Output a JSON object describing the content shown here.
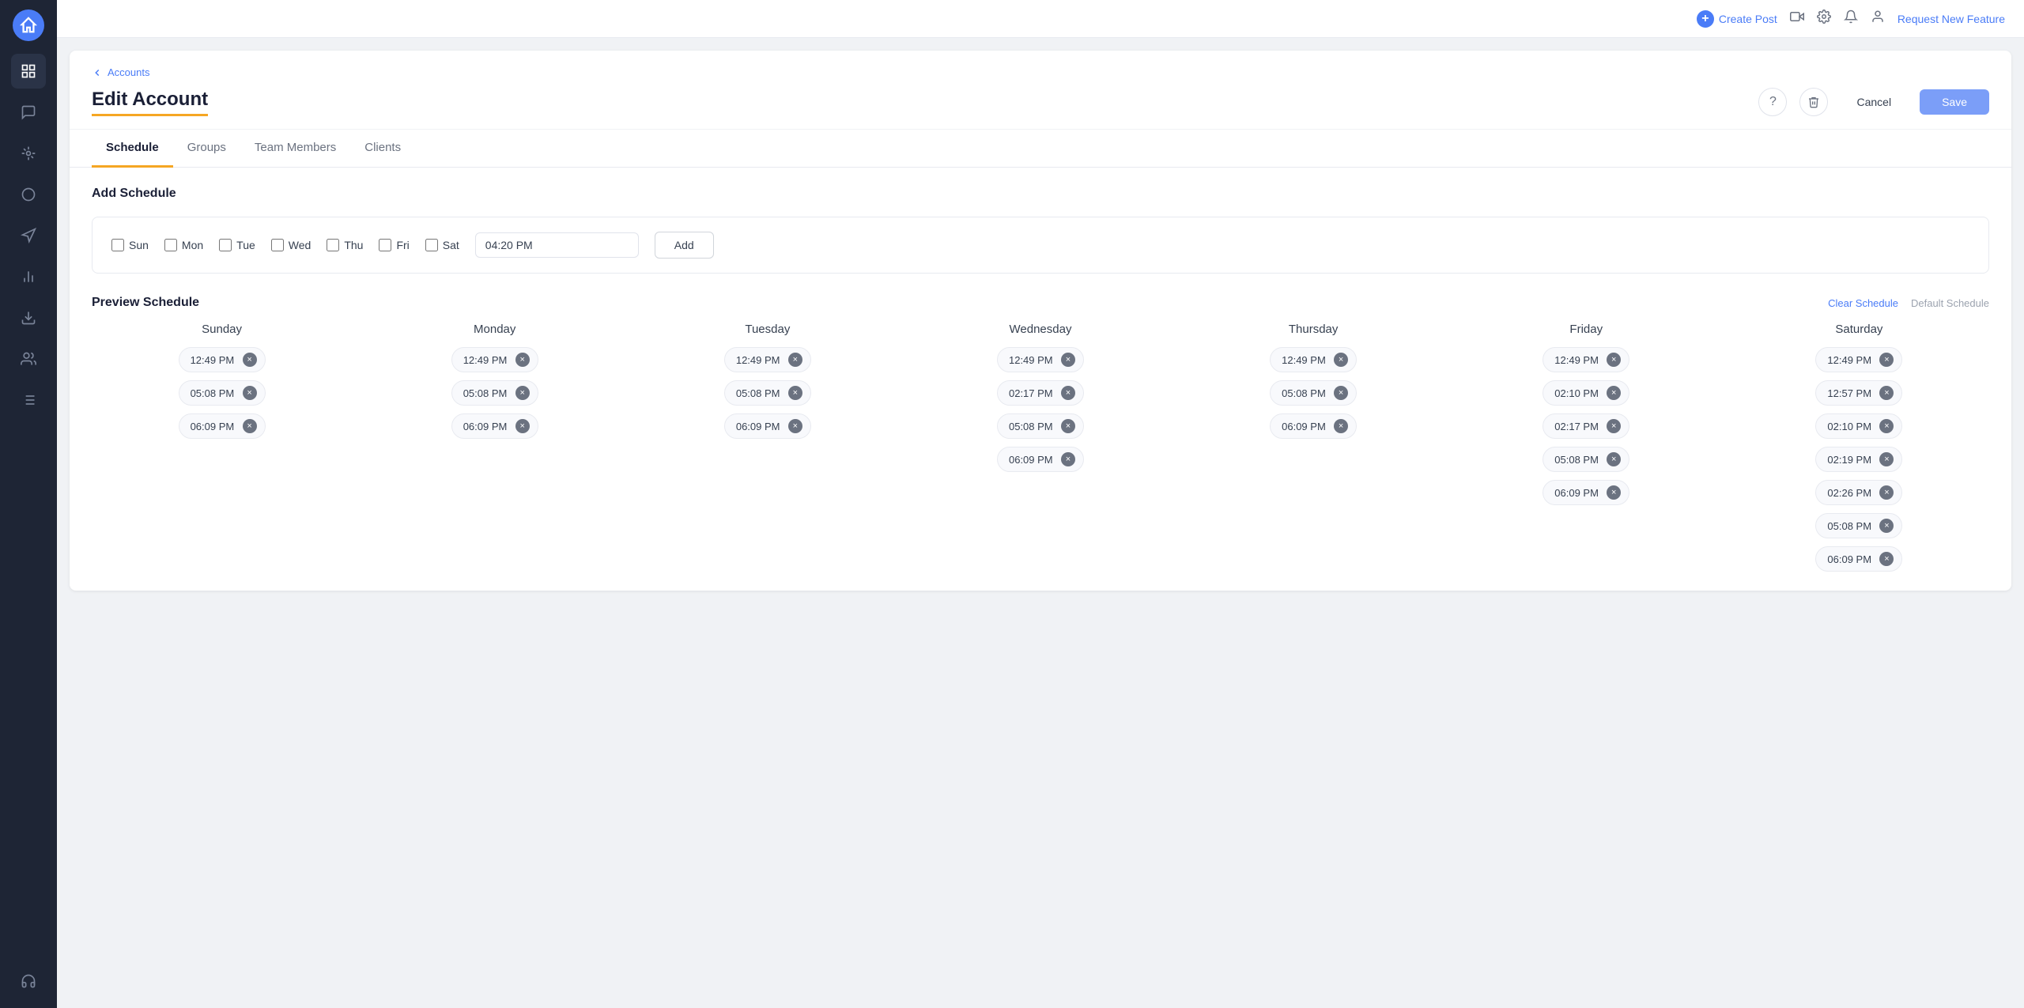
{
  "topbar": {
    "create_post_label": "Create Post",
    "request_feature_label": "Request New Feature"
  },
  "breadcrumb": {
    "label": "Accounts"
  },
  "header": {
    "title": "Edit Account",
    "cancel_label": "Cancel",
    "save_label": "Save"
  },
  "tabs": [
    {
      "id": "schedule",
      "label": "Schedule",
      "active": true
    },
    {
      "id": "groups",
      "label": "Groups",
      "active": false
    },
    {
      "id": "team-members",
      "label": "Team Members",
      "active": false
    },
    {
      "id": "clients",
      "label": "Clients",
      "active": false
    }
  ],
  "add_schedule": {
    "title": "Add Schedule",
    "days": [
      {
        "id": "sun",
        "label": "Sun",
        "checked": false
      },
      {
        "id": "mon",
        "label": "Mon",
        "checked": false
      },
      {
        "id": "tue",
        "label": "Tue",
        "checked": false
      },
      {
        "id": "wed",
        "label": "Wed",
        "checked": false
      },
      {
        "id": "thu",
        "label": "Thu",
        "checked": false
      },
      {
        "id": "fri",
        "label": "Fri",
        "checked": false
      },
      {
        "id": "sat",
        "label": "Sat",
        "checked": false
      }
    ],
    "time_value": "04:20 PM",
    "add_button_label": "Add"
  },
  "preview_schedule": {
    "title": "Preview Schedule",
    "clear_label": "Clear Schedule",
    "default_label": "Default Schedule",
    "days": [
      {
        "name": "Sunday",
        "slots": [
          "12:49 PM",
          "05:08 PM",
          "06:09 PM"
        ]
      },
      {
        "name": "Monday",
        "slots": [
          "12:49 PM",
          "05:08 PM",
          "06:09 PM"
        ]
      },
      {
        "name": "Tuesday",
        "slots": [
          "12:49 PM",
          "05:08 PM",
          "06:09 PM"
        ]
      },
      {
        "name": "Wednesday",
        "slots": [
          "12:49 PM",
          "02:17 PM",
          "05:08 PM",
          "06:09 PM"
        ]
      },
      {
        "name": "Thursday",
        "slots": [
          "12:49 PM",
          "05:08 PM",
          "06:09 PM"
        ]
      },
      {
        "name": "Friday",
        "slots": [
          "12:49 PM",
          "02:10 PM",
          "02:17 PM",
          "05:08 PM",
          "06:09 PM"
        ]
      },
      {
        "name": "Saturday",
        "slots": [
          "12:49 PM",
          "12:57 PM",
          "02:10 PM",
          "02:19 PM",
          "02:26 PM",
          "05:08 PM",
          "06:09 PM"
        ]
      }
    ]
  },
  "sidebar": {
    "icons": [
      {
        "name": "dashboard-icon",
        "symbol": "⊞"
      },
      {
        "name": "chat-icon",
        "symbol": "💬"
      },
      {
        "name": "network-icon",
        "symbol": "✦"
      },
      {
        "name": "loop-icon",
        "symbol": "○"
      },
      {
        "name": "megaphone-icon",
        "symbol": "📢"
      },
      {
        "name": "chart-icon",
        "symbol": "📊"
      },
      {
        "name": "download-icon",
        "symbol": "⬇"
      },
      {
        "name": "team-icon",
        "symbol": "👥"
      },
      {
        "name": "list-icon",
        "symbol": "☰"
      },
      {
        "name": "support-icon",
        "symbol": "🎧"
      }
    ]
  }
}
